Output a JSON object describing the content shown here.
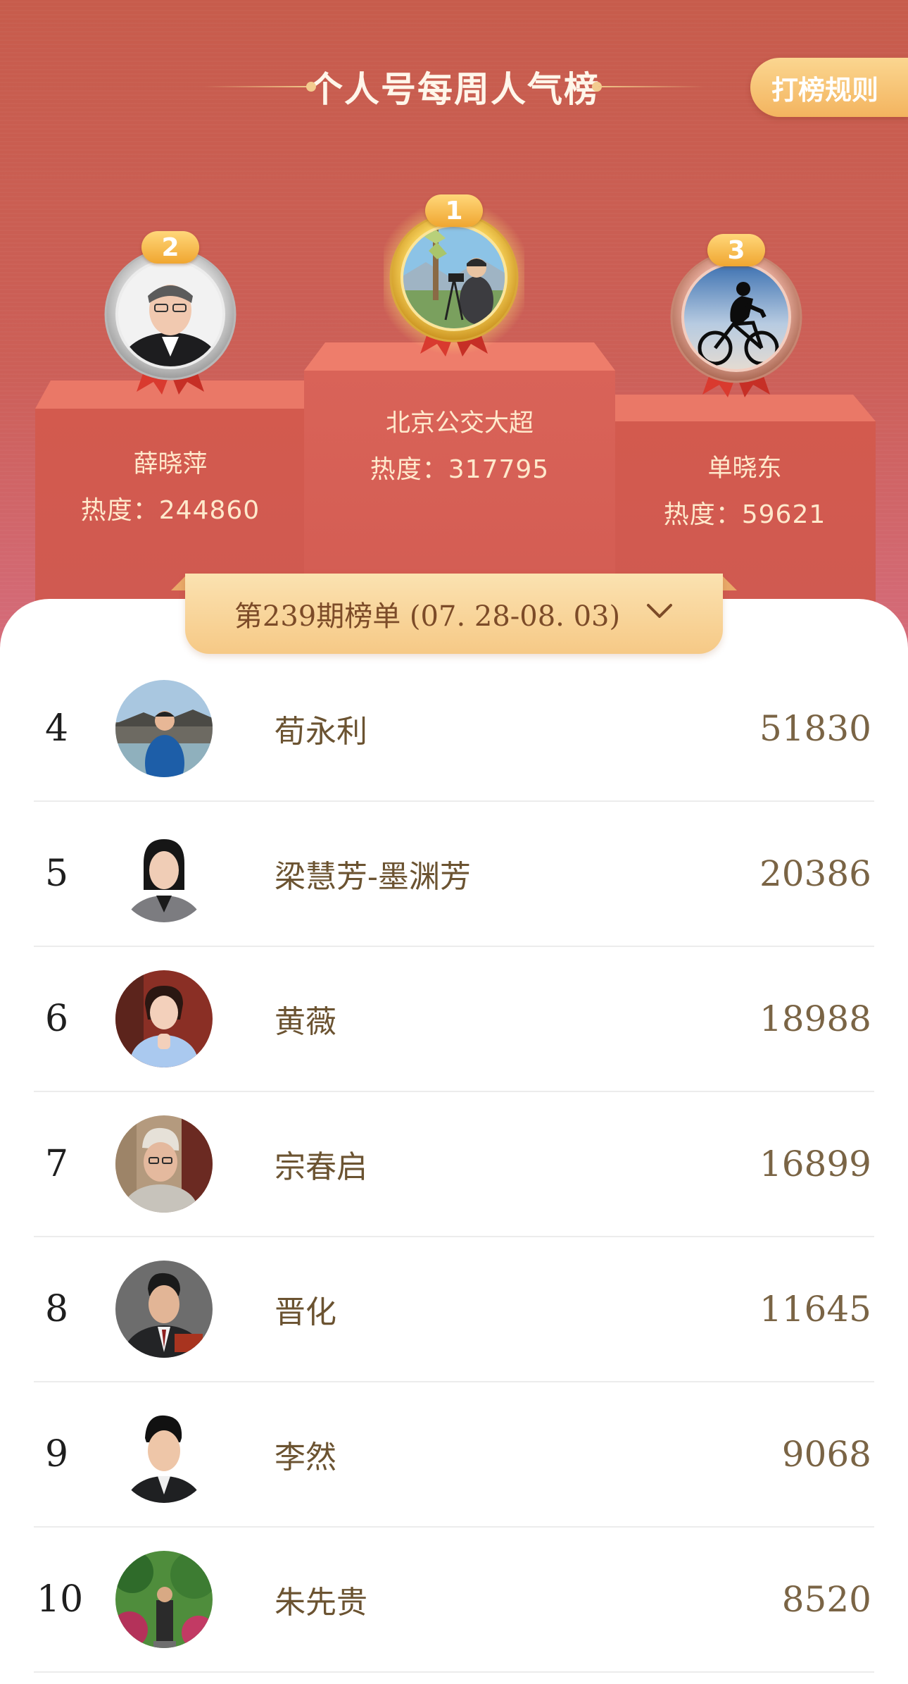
{
  "header": {
    "title": "个人号每周人气榜",
    "rules_button": "打榜规则"
  },
  "podium": {
    "first": {
      "rank": "1",
      "name": "北京公交大超",
      "heat": "热度：317795"
    },
    "second": {
      "rank": "2",
      "name": "薛晓萍",
      "heat": "热度：244860"
    },
    "third": {
      "rank": "3",
      "name": "单晓东",
      "heat": "热度：59621"
    }
  },
  "period": {
    "label": "第239期榜单 (07. 28-08. 03)"
  },
  "ranking": [
    {
      "rank": "4",
      "name": "荀永利",
      "score": "51830"
    },
    {
      "rank": "5",
      "name": "梁慧芳-墨渊芳",
      "score": "20386"
    },
    {
      "rank": "6",
      "name": "黄薇",
      "score": "18988"
    },
    {
      "rank": "7",
      "name": "宗春启",
      "score": "16899"
    },
    {
      "rank": "8",
      "name": "晋化",
      "score": "11645"
    },
    {
      "rank": "9",
      "name": "李然",
      "score": "9068"
    },
    {
      "rank": "10",
      "name": "朱先贵",
      "score": "8520"
    }
  ],
  "colors": {
    "hero_top": "#c75c4c",
    "hero_bottom": "#d56c7c",
    "gold": "#f6c986",
    "name_text": "#6b5331",
    "score_text": "#7a6445"
  },
  "icons": {
    "dropdown": "chevron-down-icon",
    "medal": "medal-icon",
    "ribbon": "ribbon-icon"
  }
}
